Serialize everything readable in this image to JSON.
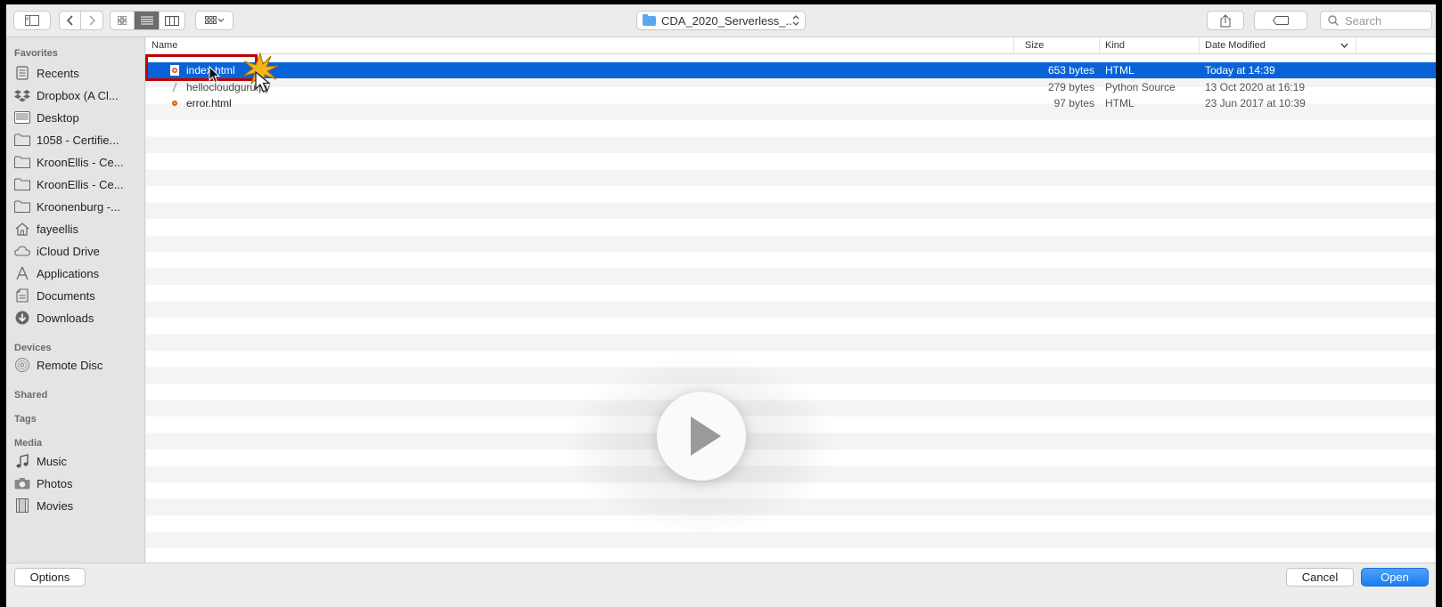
{
  "toolbar": {
    "location": "CDA_2020_Serverless_...",
    "search_placeholder": "Search"
  },
  "sidebar": {
    "sections": {
      "favorites": "Favorites",
      "devices": "Devices",
      "shared": "Shared",
      "tags": "Tags",
      "media": "Media"
    },
    "favorites": [
      {
        "label": "Recents",
        "icon": "recents-icon"
      },
      {
        "label": "Dropbox (A Cl...",
        "icon": "dropbox-icon"
      },
      {
        "label": "Desktop",
        "icon": "desktop-icon"
      },
      {
        "label": "1058 - Certifie...",
        "icon": "folder-icon"
      },
      {
        "label": "KroonEllis - Ce...",
        "icon": "folder-icon"
      },
      {
        "label": "KroonEllis - Ce...",
        "icon": "folder-icon"
      },
      {
        "label": "Kroonenburg -...",
        "icon": "folder-icon"
      },
      {
        "label": "fayeellis",
        "icon": "home-icon"
      },
      {
        "label": "iCloud Drive",
        "icon": "cloud-icon"
      },
      {
        "label": "Applications",
        "icon": "applications-icon"
      },
      {
        "label": "Documents",
        "icon": "documents-icon"
      },
      {
        "label": "Downloads",
        "icon": "downloads-icon"
      }
    ],
    "devices": [
      {
        "label": "Remote Disc",
        "icon": "disc-icon"
      }
    ],
    "media": [
      {
        "label": "Music",
        "icon": "music-icon"
      },
      {
        "label": "Photos",
        "icon": "camera-icon"
      },
      {
        "label": "Movies",
        "icon": "film-icon"
      }
    ]
  },
  "columns": {
    "name": "Name",
    "size": "Size",
    "kind": "Kind",
    "date": "Date Modified"
  },
  "files": [
    {
      "name": "index.html",
      "size": "653 bytes",
      "kind": "HTML",
      "date": "Today at 14:39",
      "selected": true
    },
    {
      "name": "hellocloudguru.py",
      "size": "279 bytes",
      "kind": "Python Source",
      "date": "13 Oct 2020 at 16:19",
      "selected": false
    },
    {
      "name": "error.html",
      "size": "97 bytes",
      "kind": "HTML",
      "date": "23 Jun 2017 at 10:39",
      "selected": false
    }
  ],
  "buttons": {
    "options": "Options",
    "cancel": "Cancel",
    "open": "Open"
  },
  "colors": {
    "selection": "#0a63d6",
    "highlight_box": "#c00000",
    "primary_button": "#1b7cf0"
  }
}
